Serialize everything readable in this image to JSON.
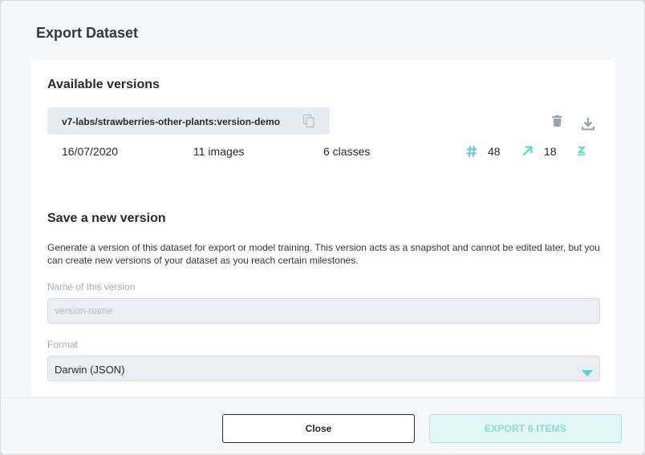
{
  "dialog": {
    "title": "Export Dataset"
  },
  "available_versions": {
    "title": "Available versions",
    "versions": [
      {
        "name": "v7-labs/strawberries-other-plants:version-demo",
        "date": "16/07/2020",
        "images": "11 images",
        "classes": "6 classes",
        "tag_count": "48",
        "annotation_count": "18",
        "icons": {
          "copy": "copy-icon",
          "delete": "trash-icon",
          "download": "download-icon",
          "tag": "hash-icon",
          "annotation": "arrow-up-right-icon",
          "extra": "brush-icon"
        }
      }
    ]
  },
  "new_version": {
    "title": "Save a new version",
    "description": "Generate a version of this dataset for export or model training. This version acts as a snapshot and cannot be edited later, but you can create new versions of your dataset as you reach certain milestones.",
    "name_label": "Name of this version",
    "name_placeholder": "version-name",
    "name_value": "",
    "format_label": "Format",
    "format_value": "Darwin (JSON)"
  },
  "footer": {
    "close_label": "Close",
    "export_label": "EXPORT 6 ITEMS"
  },
  "colors": {
    "accent": "#5fd0c4",
    "accent_light": "#e0f7f5",
    "icon_gray": "#9aa2aa"
  }
}
